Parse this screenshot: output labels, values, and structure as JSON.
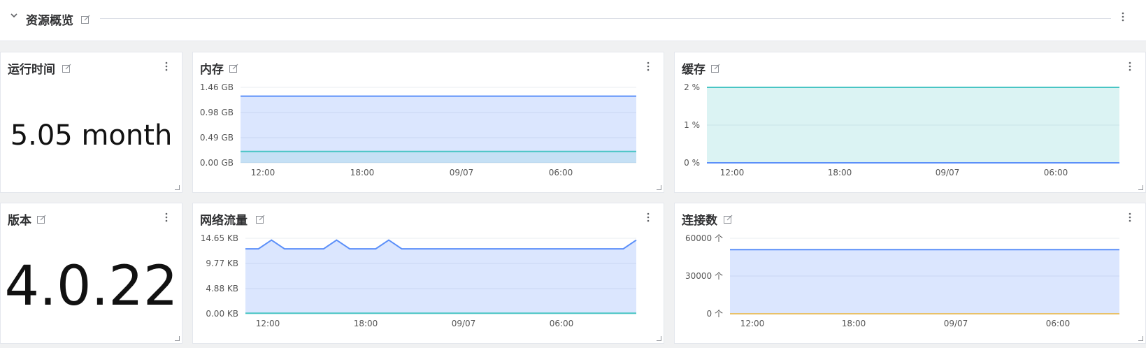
{
  "row": {
    "title": "资源概览"
  },
  "panels": {
    "uptime": {
      "title": "运行时间",
      "value": "5.05 month"
    },
    "version": {
      "title": "版本",
      "value": "4.0.22"
    },
    "memory": {
      "title": "内存",
      "chart_data": {
        "type": "area",
        "title": "内存",
        "y_ticks": [
          "1.46 GB",
          "0.98 GB",
          "0.49 GB",
          "0.00 GB"
        ],
        "x_ticks": [
          "12:00",
          "18:00",
          "09/07",
          "06:00"
        ],
        "ylim": [
          0,
          1.46
        ],
        "series": [
          {
            "color": "#5b8ff9",
            "values": [
              1.29,
              1.29
            ]
          },
          {
            "color": "#49c5c4",
            "values": [
              0.22,
              0.22
            ]
          }
        ]
      }
    },
    "cache": {
      "title": "缓存",
      "chart_data": {
        "type": "area",
        "title": "缓存",
        "y_ticks": [
          "2 %",
          "1 %",
          "0 %"
        ],
        "x_ticks": [
          "12:00",
          "18:00",
          "09/07",
          "06:00"
        ],
        "ylim": [
          0,
          2
        ],
        "series": [
          {
            "color": "#49c5c4",
            "values": [
              2,
              2
            ]
          },
          {
            "color": "#5b8ff9",
            "values": [
              0,
              0
            ]
          }
        ]
      }
    },
    "network": {
      "title": "网络流量",
      "chart_data": {
        "type": "area",
        "title": "网络流量",
        "y_ticks": [
          "14.65 KB",
          "9.77 KB",
          "4.88 KB",
          "0.00 KB"
        ],
        "x_ticks": [
          "12:00",
          "18:00",
          "09/07",
          "06:00"
        ],
        "ylim": [
          0,
          14.65
        ],
        "series": [
          {
            "color": "#5b8ff9",
            "values": [
              12.6,
              12.6,
              14.3,
              12.6,
              12.6,
              12.6,
              12.6,
              14.3,
              12.6,
              12.6,
              12.6,
              14.3,
              12.6,
              12.6,
              12.6,
              12.6,
              12.6,
              12.6,
              12.6,
              12.6,
              12.6,
              12.6,
              12.6,
              12.6,
              12.6,
              12.6,
              12.6,
              12.6,
              12.6,
              12.6,
              14.3
            ]
          },
          {
            "color": "#49c5c4",
            "values": [
              0.1,
              0.1
            ]
          }
        ]
      }
    },
    "connections": {
      "title": "连接数",
      "chart_data": {
        "type": "area",
        "title": "连接数",
        "y_ticks": [
          "60000 个",
          "30000 个",
          "0 个"
        ],
        "x_ticks": [
          "12:00",
          "18:00",
          "09/07",
          "06:00"
        ],
        "ylim": [
          0,
          60000
        ],
        "series": [
          {
            "color": "#5b8ff9",
            "values": [
              51000,
              51000
            ]
          },
          {
            "color": "#e8c16a",
            "values": [
              0,
              0
            ]
          }
        ]
      }
    }
  }
}
